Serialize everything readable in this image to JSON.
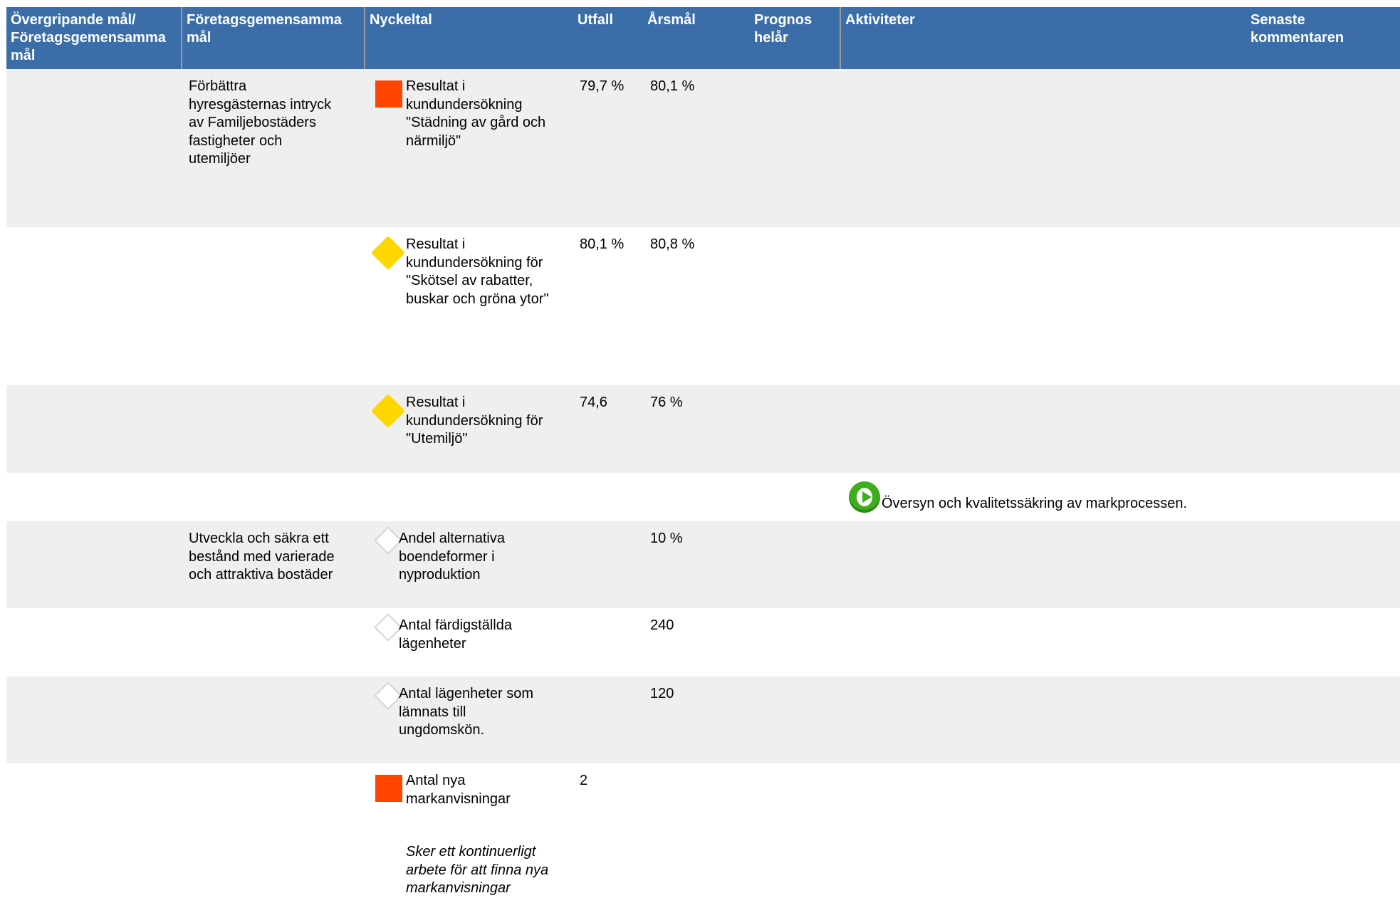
{
  "header": {
    "col1": "Övergripande mål/\nFöretagsgemensamma\nmål",
    "col2": "Företagsgemensamma\nmål",
    "col3": "Nyckeltal",
    "col4": "Utfall",
    "col5": "Årsmål",
    "col6": "Prognos\nhelår",
    "col7": "Aktiviteter",
    "col8": "Senaste\nkommentaren"
  },
  "colors": {
    "header_bg": "#3b6ea8",
    "row_shade": "#efefef",
    "status_red": "#ff4500",
    "status_yellow": "#ffd700",
    "activity_green": "#3fae1e"
  },
  "goals": [
    "Förbättra\nhyresgästernas intryck\nav Familjebostäders\nfastigheter och\nutemiljöer",
    "Utveckla och säkra ett\nbestånd med varierade\noch attraktiva bostäder"
  ],
  "kpis": [
    {
      "name": "Resultat i\nkundundersökning\n\"Städning av gård och\nnärmiljö\"",
      "status_icon": "red-square-icon",
      "outcome": "79,7 %",
      "target": "80,1 %"
    },
    {
      "name": "Resultat i\nkundundersökning för\n\"Skötsel av rabatter,\nbuskar och gröna ytor\"",
      "status_icon": "yellow-diamond-icon",
      "outcome": "80,1 %",
      "target": "80,8 %"
    },
    {
      "name": "Resultat i\nkundundersökning för\n\"Utemiljö\"",
      "status_icon": "yellow-diamond-icon",
      "outcome": "74,6",
      "target": "76 %"
    },
    {
      "name": "Andel alternativa\nboendeformer i\nnyproduktion",
      "status_icon": "white-diamond-icon",
      "outcome": "",
      "target": "10 %"
    },
    {
      "name": "Antal färdigställda\nlägenheter",
      "status_icon": "white-diamond-icon",
      "outcome": "",
      "target": "240"
    },
    {
      "name": "Antal lägenheter som\nlämnats till\nungdomskön.",
      "status_icon": "white-diamond-icon",
      "outcome": "",
      "target": "120"
    },
    {
      "name": "Antal nya\nmarkanvisningar",
      "status_icon": "red-square-icon",
      "outcome": "2",
      "target": "",
      "note": "Sker ett kontinuerligt\narbete för att finna nya\nmarkanvisningar"
    }
  ],
  "activities": [
    {
      "status_icon": "play-icon",
      "text": "Översyn och kvalitetssäkring av markprocessen."
    }
  ]
}
